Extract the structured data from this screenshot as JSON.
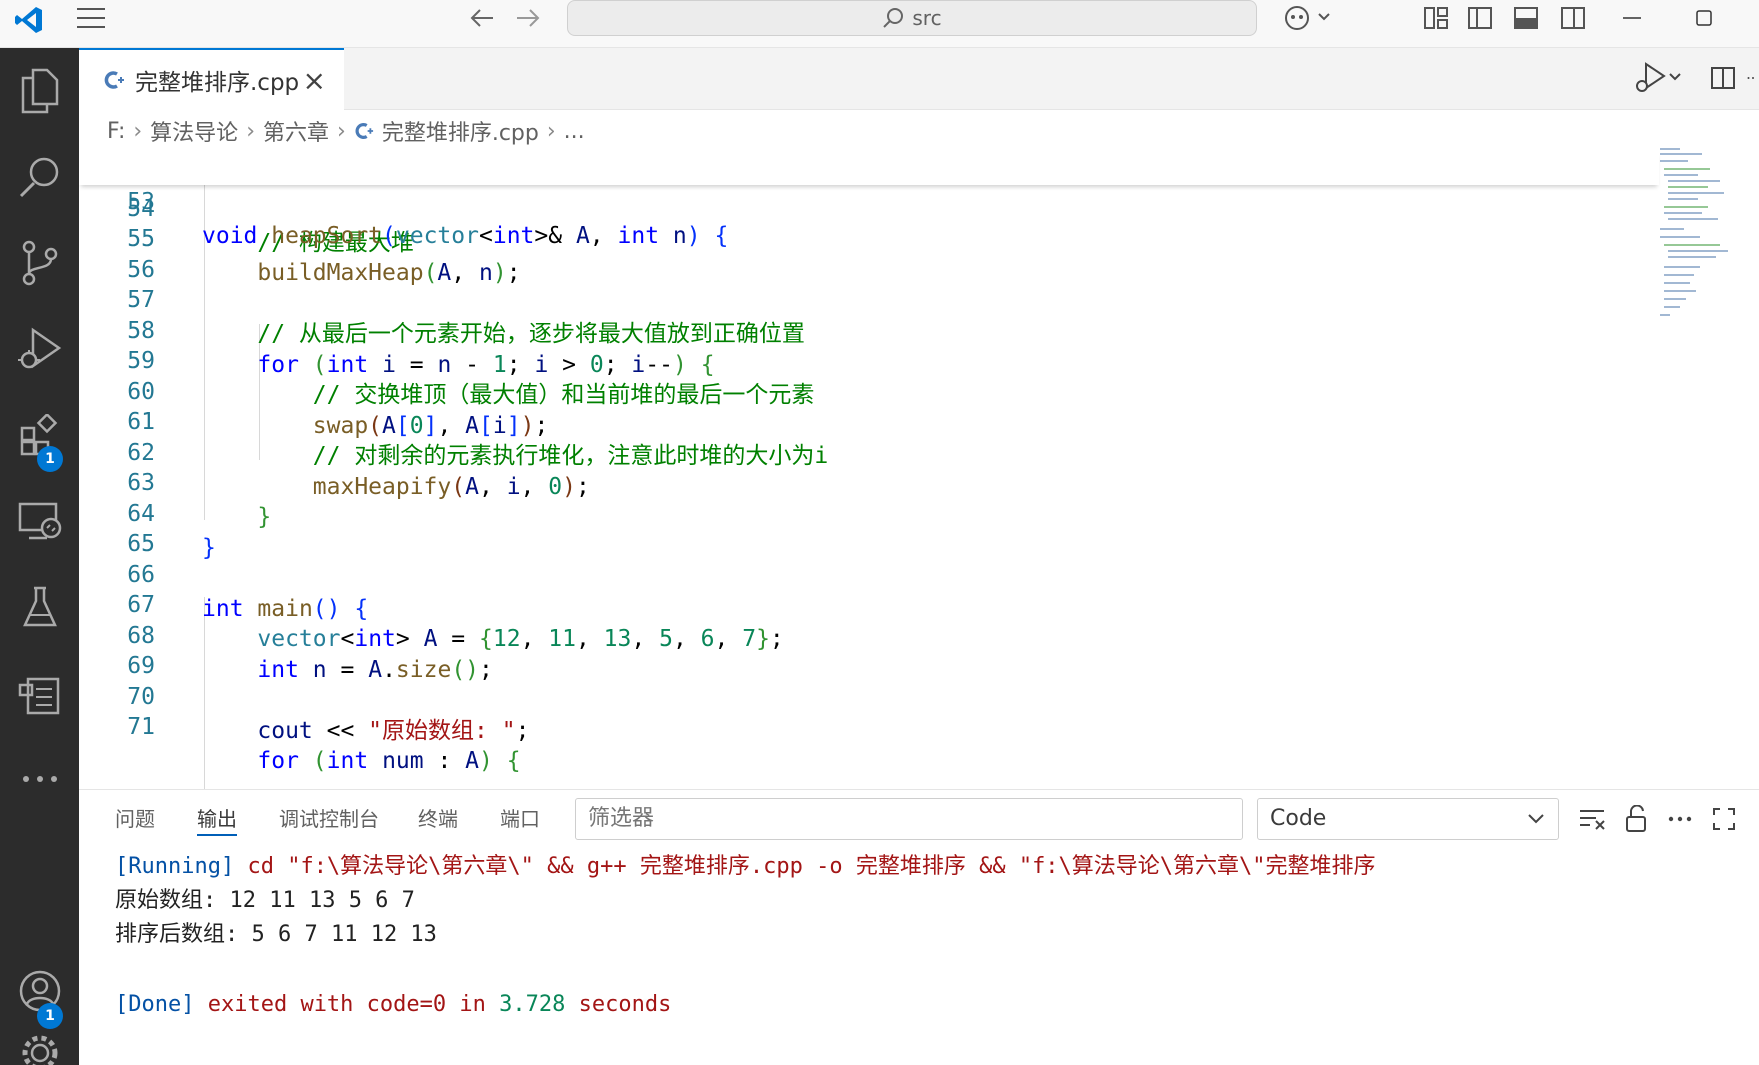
{
  "titlebar": {
    "search_text": "src"
  },
  "activity": {
    "extensions_badge": "1",
    "accounts_badge": "1"
  },
  "tab": {
    "label": "完整堆排序.cpp",
    "close": "×"
  },
  "breadcrumb": {
    "drive": "F:",
    "folder1": "算法导论",
    "folder2": "第六章",
    "file": "完整堆排序.cpp",
    "more": "..."
  },
  "editor": {
    "line_numbers": [
      "53",
      "54",
      "55",
      "56",
      "57",
      "58",
      "59",
      "60",
      "61",
      "62",
      "63",
      "64",
      "65",
      "66",
      "67",
      "68",
      "69",
      "70",
      "71"
    ],
    "sticky": {
      "kw": "void",
      "fn": "heapSort",
      "ty1": "vector",
      "ty2": "int",
      "arg1": "A",
      "kw2": "int",
      "arg2": "n"
    },
    "l54_comment": "// 构建最大堆",
    "l55_fn": "buildMaxHeap",
    "l55_a": "A",
    "l55_n": "n",
    "l57_comment": "// 从最后一个元素开始，逐步将最大值放到正确位置",
    "l58_for": "for",
    "l58_int": "int",
    "l58_one": "1",
    "l58_zero": "0",
    "l59_comment": "// 交换堆顶（最大值）和当前堆的最后一个元素",
    "l60_fn": "swap",
    "l60_zero": "0",
    "l61_comment": "// 对剩余的元素执行堆化，注意此时堆的大小为i",
    "l62_fn": "maxHeapify",
    "l62_zero": "0",
    "l66_int": "int",
    "l66_fn": "main",
    "l67_ty": "vector",
    "l67_int": "int",
    "l67_values": [
      "12",
      "11",
      "13",
      "5",
      "6",
      "7"
    ],
    "l68_int": "int",
    "l68_fn": "size",
    "l70_cout": "cout",
    "l70_str": "\"原始数组: \"",
    "l71_for": "for",
    "l71_int": "int",
    "l71_var": "num"
  },
  "panel": {
    "tabs": [
      "问题",
      "输出",
      "调试控制台",
      "终端",
      "端口"
    ],
    "active_tab": "输出",
    "filter_placeholder": "筛选器",
    "channel": "Code",
    "output": {
      "running_tag": "[Running]",
      "running_cmd": " cd \"f:\\算法导论\\第六章\\\" && g++ 完整堆排序.cpp -o 完整堆排序 && \"f:\\算法导论\\第六章\\\"完整堆排序",
      "line1": "原始数组: 12 11 13 5 6 7",
      "line2": "排序后数组: 5 6 7 11 12 13",
      "done_tag": "[Done]",
      "done_text1": " exited with ",
      "done_code": "code=0",
      "done_text2": " in ",
      "done_secs": "3.728",
      "done_text3": " seconds"
    }
  },
  "colors": {
    "accent": "#0078d4",
    "activity_bg": "#2c2c2c",
    "keyword": "#0000ff",
    "comment": "#008000",
    "number": "#098658"
  }
}
